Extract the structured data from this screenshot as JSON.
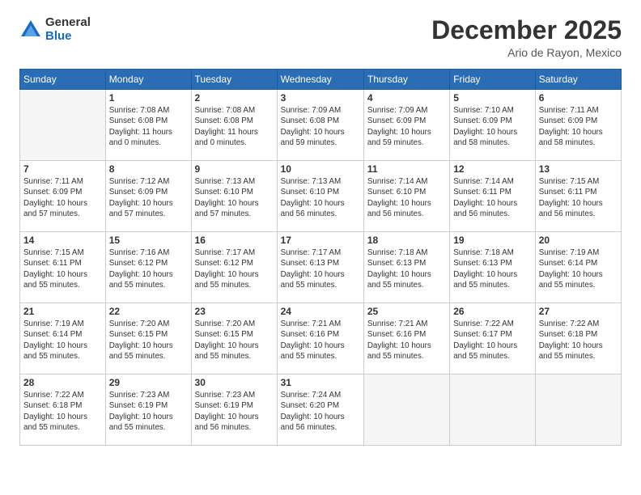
{
  "logo": {
    "general": "General",
    "blue": "Blue"
  },
  "title": "December 2025",
  "subtitle": "Ario de Rayon, Mexico",
  "days_header": [
    "Sunday",
    "Monday",
    "Tuesday",
    "Wednesday",
    "Thursday",
    "Friday",
    "Saturday"
  ],
  "weeks": [
    [
      {
        "num": "",
        "info": ""
      },
      {
        "num": "1",
        "info": "Sunrise: 7:08 AM\nSunset: 6:08 PM\nDaylight: 11 hours\nand 0 minutes."
      },
      {
        "num": "2",
        "info": "Sunrise: 7:08 AM\nSunset: 6:08 PM\nDaylight: 11 hours\nand 0 minutes."
      },
      {
        "num": "3",
        "info": "Sunrise: 7:09 AM\nSunset: 6:08 PM\nDaylight: 10 hours\nand 59 minutes."
      },
      {
        "num": "4",
        "info": "Sunrise: 7:09 AM\nSunset: 6:09 PM\nDaylight: 10 hours\nand 59 minutes."
      },
      {
        "num": "5",
        "info": "Sunrise: 7:10 AM\nSunset: 6:09 PM\nDaylight: 10 hours\nand 58 minutes."
      },
      {
        "num": "6",
        "info": "Sunrise: 7:11 AM\nSunset: 6:09 PM\nDaylight: 10 hours\nand 58 minutes."
      }
    ],
    [
      {
        "num": "7",
        "info": "Sunrise: 7:11 AM\nSunset: 6:09 PM\nDaylight: 10 hours\nand 57 minutes."
      },
      {
        "num": "8",
        "info": "Sunrise: 7:12 AM\nSunset: 6:09 PM\nDaylight: 10 hours\nand 57 minutes."
      },
      {
        "num": "9",
        "info": "Sunrise: 7:13 AM\nSunset: 6:10 PM\nDaylight: 10 hours\nand 57 minutes."
      },
      {
        "num": "10",
        "info": "Sunrise: 7:13 AM\nSunset: 6:10 PM\nDaylight: 10 hours\nand 56 minutes."
      },
      {
        "num": "11",
        "info": "Sunrise: 7:14 AM\nSunset: 6:10 PM\nDaylight: 10 hours\nand 56 minutes."
      },
      {
        "num": "12",
        "info": "Sunrise: 7:14 AM\nSunset: 6:11 PM\nDaylight: 10 hours\nand 56 minutes."
      },
      {
        "num": "13",
        "info": "Sunrise: 7:15 AM\nSunset: 6:11 PM\nDaylight: 10 hours\nand 56 minutes."
      }
    ],
    [
      {
        "num": "14",
        "info": "Sunrise: 7:15 AM\nSunset: 6:11 PM\nDaylight: 10 hours\nand 55 minutes."
      },
      {
        "num": "15",
        "info": "Sunrise: 7:16 AM\nSunset: 6:12 PM\nDaylight: 10 hours\nand 55 minutes."
      },
      {
        "num": "16",
        "info": "Sunrise: 7:17 AM\nSunset: 6:12 PM\nDaylight: 10 hours\nand 55 minutes."
      },
      {
        "num": "17",
        "info": "Sunrise: 7:17 AM\nSunset: 6:13 PM\nDaylight: 10 hours\nand 55 minutes."
      },
      {
        "num": "18",
        "info": "Sunrise: 7:18 AM\nSunset: 6:13 PM\nDaylight: 10 hours\nand 55 minutes."
      },
      {
        "num": "19",
        "info": "Sunrise: 7:18 AM\nSunset: 6:13 PM\nDaylight: 10 hours\nand 55 minutes."
      },
      {
        "num": "20",
        "info": "Sunrise: 7:19 AM\nSunset: 6:14 PM\nDaylight: 10 hours\nand 55 minutes."
      }
    ],
    [
      {
        "num": "21",
        "info": "Sunrise: 7:19 AM\nSunset: 6:14 PM\nDaylight: 10 hours\nand 55 minutes."
      },
      {
        "num": "22",
        "info": "Sunrise: 7:20 AM\nSunset: 6:15 PM\nDaylight: 10 hours\nand 55 minutes."
      },
      {
        "num": "23",
        "info": "Sunrise: 7:20 AM\nSunset: 6:15 PM\nDaylight: 10 hours\nand 55 minutes."
      },
      {
        "num": "24",
        "info": "Sunrise: 7:21 AM\nSunset: 6:16 PM\nDaylight: 10 hours\nand 55 minutes."
      },
      {
        "num": "25",
        "info": "Sunrise: 7:21 AM\nSunset: 6:16 PM\nDaylight: 10 hours\nand 55 minutes."
      },
      {
        "num": "26",
        "info": "Sunrise: 7:22 AM\nSunset: 6:17 PM\nDaylight: 10 hours\nand 55 minutes."
      },
      {
        "num": "27",
        "info": "Sunrise: 7:22 AM\nSunset: 6:18 PM\nDaylight: 10 hours\nand 55 minutes."
      }
    ],
    [
      {
        "num": "28",
        "info": "Sunrise: 7:22 AM\nSunset: 6:18 PM\nDaylight: 10 hours\nand 55 minutes."
      },
      {
        "num": "29",
        "info": "Sunrise: 7:23 AM\nSunset: 6:19 PM\nDaylight: 10 hours\nand 55 minutes."
      },
      {
        "num": "30",
        "info": "Sunrise: 7:23 AM\nSunset: 6:19 PM\nDaylight: 10 hours\nand 56 minutes."
      },
      {
        "num": "31",
        "info": "Sunrise: 7:24 AM\nSunset: 6:20 PM\nDaylight: 10 hours\nand 56 minutes."
      },
      {
        "num": "",
        "info": ""
      },
      {
        "num": "",
        "info": ""
      },
      {
        "num": "",
        "info": ""
      }
    ]
  ]
}
